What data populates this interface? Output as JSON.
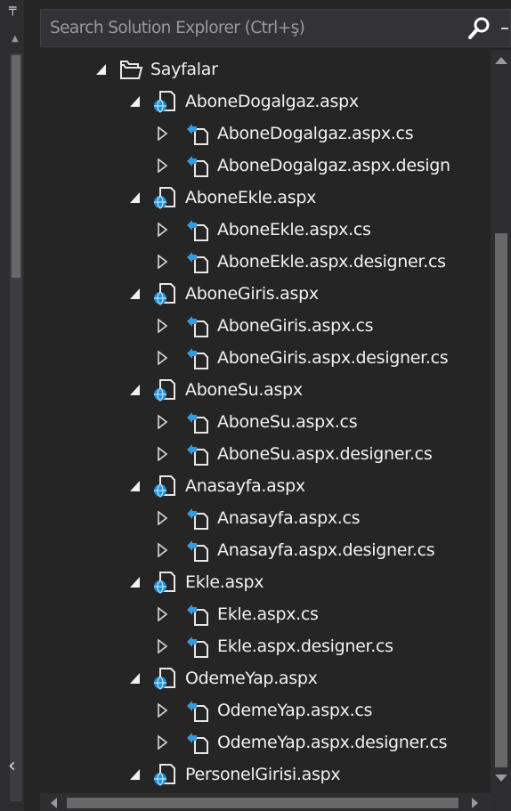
{
  "search": {
    "placeholder": "Search Solution Explorer (Ctrl+ş)",
    "icon": "search-icon"
  },
  "tree": {
    "root": {
      "label": "Sayfalar",
      "icon": "folder-open-icon",
      "expanded": true
    },
    "pages": [
      {
        "label": "AboneDogalgaz.aspx",
        "children": [
          "AboneDogalgaz.aspx.cs",
          "AboneDogalgaz.aspx.design"
        ]
      },
      {
        "label": "AboneEkle.aspx",
        "children": [
          "AboneEkle.aspx.cs",
          "AboneEkle.aspx.designer.cs"
        ]
      },
      {
        "label": "AboneGiris.aspx",
        "children": [
          "AboneGiris.aspx.cs",
          "AboneGiris.aspx.designer.cs"
        ]
      },
      {
        "label": "AboneSu.aspx",
        "children": [
          "AboneSu.aspx.cs",
          "AboneSu.aspx.designer.cs"
        ]
      },
      {
        "label": "Anasayfa.aspx",
        "children": [
          "Anasayfa.aspx.cs",
          "Anasayfa.aspx.designer.cs"
        ]
      },
      {
        "label": "Ekle.aspx",
        "children": [
          "Ekle.aspx.cs",
          "Ekle.aspx.designer.cs"
        ]
      },
      {
        "label": "OdemeYap.aspx",
        "children": [
          "OdemeYap.aspx.cs",
          "OdemeYap.aspx.designer.cs"
        ]
      },
      {
        "label": "PersonelGirisi.aspx",
        "children": []
      }
    ]
  },
  "colors": {
    "background": "#252526",
    "text": "#f1f1f1",
    "placeholder": "#999999",
    "aspx_icon_blue": "#1e90d6",
    "cs_icon_arrow": "#3a9ad9"
  }
}
